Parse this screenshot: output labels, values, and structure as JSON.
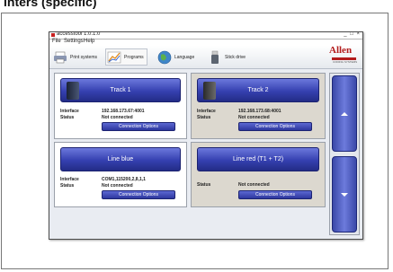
{
  "doc_heading": "inters (specific)",
  "window": {
    "title": "accesstool 1.0.1.0",
    "controls": "_ □ ×"
  },
  "menu": [
    "File",
    "Settings",
    "Help"
  ],
  "toolbar": {
    "items": [
      {
        "label": "Print systems",
        "icon": "printer-icon"
      },
      {
        "label": "Programs",
        "icon": "chart-icon"
      },
      {
        "label": "Language",
        "icon": "globe-icon"
      },
      {
        "label": "Stick drive",
        "icon": "usb-drive-icon"
      }
    ]
  },
  "logo": {
    "word": "Allen",
    "sub": "CODING SYSTEMS"
  },
  "panels": [
    {
      "header": "Track 1",
      "interface_label": "Interface",
      "interface_value": "192.168.173.67:4001",
      "status_label": "Status",
      "status_value": "Not connected",
      "button": "Connection Options"
    },
    {
      "header": "Track 2",
      "interface_label": "Interface",
      "interface_value": "192.168.173.68:4001",
      "status_label": "Status",
      "status_value": "Not connected",
      "button": "Connection Options"
    },
    {
      "header": "Line blue",
      "interface_label": "Interface",
      "interface_value": "COM1,115200,2,8,1,1",
      "status_label": "Status",
      "status_value": "Not connected",
      "button": "Connection Options"
    },
    {
      "header": "Line red (T1 + T2)",
      "status_label": "Status",
      "status_value": "Not connected",
      "button": "Connection Options"
    }
  ],
  "colors": {
    "accent": "#3540b0",
    "brand": "#b31b1b"
  }
}
